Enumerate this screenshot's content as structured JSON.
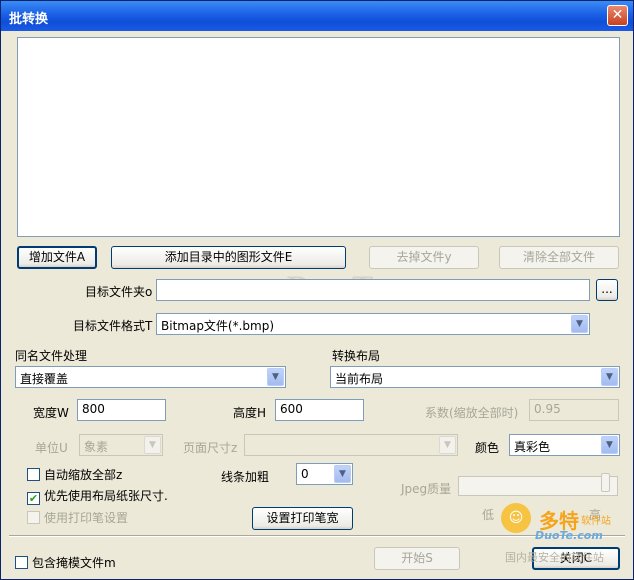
{
  "window": {
    "title": "批转换"
  },
  "file_buttons": {
    "add_file": "增加文件A",
    "add_dir_files": "添加目录中的图形文件E",
    "remove_file": "去掉文件y",
    "clear_all": "清除全部文件"
  },
  "target_folder": {
    "label": "目标文件夹o",
    "value": "",
    "browse_label": "..."
  },
  "target_format": {
    "label": "目标文件格式T",
    "value": "Bitmap文件(*.bmp)"
  },
  "same_name": {
    "label": "同名文件处理",
    "value": "直接覆盖"
  },
  "layout": {
    "label": "转换布局",
    "value": "当前布局"
  },
  "width": {
    "label": "宽度W",
    "value": "800"
  },
  "height": {
    "label": "高度H",
    "value": "600"
  },
  "coefficient": {
    "label": "系数(缩放全部时)",
    "value": "0.95"
  },
  "unit": {
    "label": "单位U",
    "value": "象素"
  },
  "page_size": {
    "label": "页面尺寸z",
    "value": ""
  },
  "color": {
    "label": "颜色",
    "value": "真彩色"
  },
  "checkboxes": {
    "auto_scale": {
      "label": "自动缩放全部z",
      "checked": false
    },
    "prefer_layout_paper": {
      "label": "优先使用布局纸张尺寸.",
      "checked": true
    },
    "use_print_pen": {
      "label": "使用打印笔设置",
      "checked": false
    },
    "include_template": {
      "label": "包含掩模文件m",
      "checked": false
    }
  },
  "line_bold": {
    "label": "线条加粗",
    "value": "0"
  },
  "jpeg": {
    "label": "Jpeg质量",
    "low_label": "低",
    "high_label": "高",
    "quality": 0.95
  },
  "set_pen_button": "设置打印笔宽",
  "start_button": "开始S",
  "close_button": "关闭C",
  "watermark": "www.DuoTe.com",
  "logo": {
    "brand": "多特",
    "brand_sub": "软件站",
    "url": "DuoTe.com",
    "slogan": "国内最安全的软件站"
  },
  "colors": {
    "title_bar": "#1b5fe6",
    "window_bg": "#ece9d8",
    "border": "#7f9db9"
  }
}
